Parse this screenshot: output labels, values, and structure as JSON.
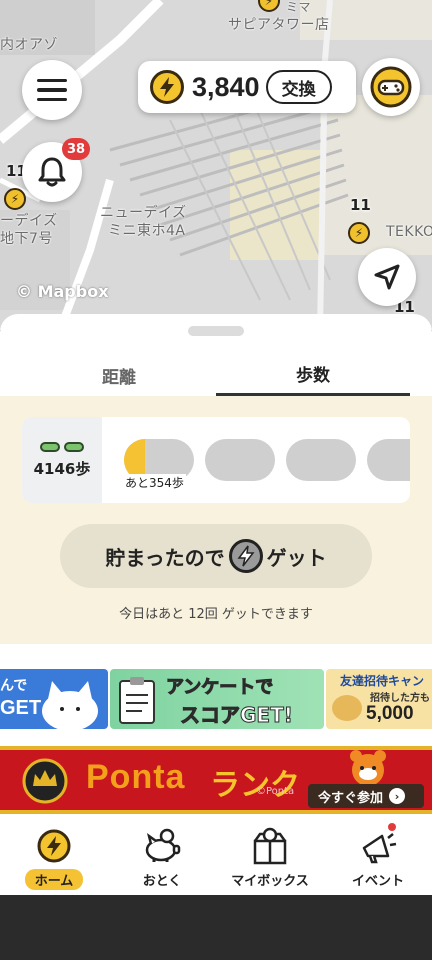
{
  "map": {
    "labels": {
      "top_left": "内オアゾ",
      "top_center": "サピアタワー店",
      "top_center_small": "ミマ",
      "newdays": "ニューデイズ",
      "newdays_sub": "ミニ東ホ4A",
      "left_store": "ーデイズ",
      "left_store_sub": "地下7号",
      "right_store": "TEKKO"
    },
    "numbers": {
      "left": "11",
      "right": "11",
      "bottom_right": "11"
    },
    "attribution": "© Mapbox"
  },
  "header": {
    "points": "3,840",
    "exchange_label": "交換",
    "notification_count": "38"
  },
  "tabs": [
    {
      "label": "距離",
      "active": false
    },
    {
      "label": "歩数",
      "active": true
    }
  ],
  "steps": {
    "count": "4146歩",
    "remaining": "あと354歩",
    "progress_fraction": 0.3
  },
  "get_button": {
    "text_before": "貯まったので",
    "text_after": "ゲット"
  },
  "get_note": "今日はあと 12回 ゲットできます",
  "banners": {
    "a_text1": "んで",
    "a_text2": "GET",
    "b_text1": "アンケートで",
    "b_text2": "スコアGET!",
    "c_text1": "友達招待キャン",
    "c_text2": "招待した方も",
    "c_text3": "5,000"
  },
  "ponta": {
    "logo": "Ponta",
    "rank": "ランク",
    "copyright": "©Ponta",
    "join": "今すぐ参加"
  },
  "bottom_nav": [
    {
      "label": "ホーム",
      "icon": "bolt-coin-icon",
      "active": true
    },
    {
      "label": "おとく",
      "icon": "piggy-bank-icon",
      "active": false
    },
    {
      "label": "マイボックス",
      "icon": "gift-box-icon",
      "active": false
    },
    {
      "label": "イベント",
      "icon": "megaphone-icon",
      "active": false
    }
  ],
  "colors": {
    "accent_yellow": "#f4c232",
    "badge_red": "#e23b3b",
    "steps_bg": "#f8f2df",
    "ponta_red": "#c8161e"
  }
}
